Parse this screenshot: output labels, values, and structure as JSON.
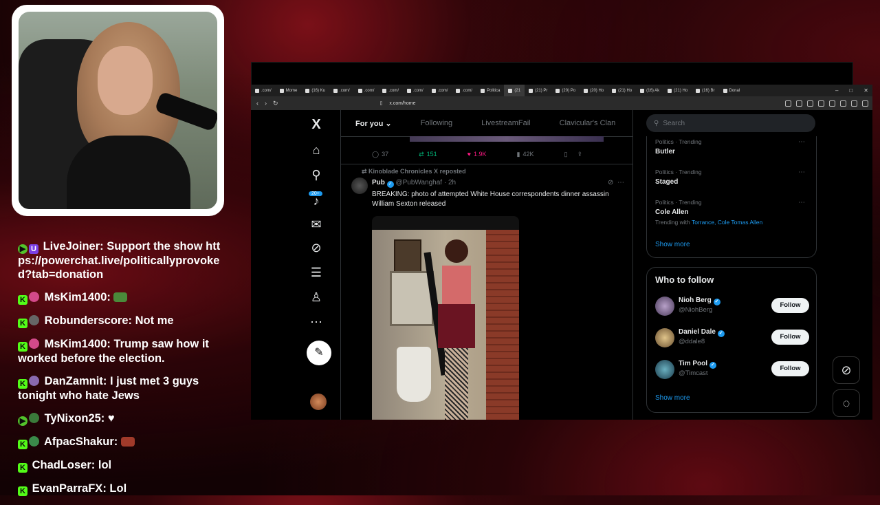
{
  "chat": [
    {
      "badge": "play",
      "badge2": "u",
      "user": "LiveJoiner:",
      "text": "Support the show https://powerchat.live/politicallyprovoked?tab=donation",
      "avatar": ""
    },
    {
      "badge": "k",
      "user": "MsKim1400:",
      "text": "",
      "avatar": "#d34a8a",
      "emote": "#4a8a3a"
    },
    {
      "badge": "k",
      "user": "Robunderscore:",
      "text": "Not me",
      "avatar": "#555"
    },
    {
      "badge": "k",
      "user": "MsKim1400:",
      "text": "Trump saw how it worked before the election.",
      "avatar": "#d34a8a"
    },
    {
      "badge": "k",
      "user": "DanZamnit:",
      "text": "I just met 3 guys tonight who hate Jews",
      "avatar": "#8a6ab0"
    },
    {
      "badge": "play",
      "user": "TyNixon25:",
      "text": "♥",
      "avatar": "#3a7a3a"
    },
    {
      "badge": "k",
      "user": "AfpacShakur:",
      "text": "",
      "avatar": "#3a8a4a",
      "emote": "#a03a2a"
    },
    {
      "badge": "k",
      "user": "ChadLoser:",
      "text": "lol",
      "avatar": ""
    },
    {
      "badge": "k",
      "user": "EvanParraFX:",
      "text": "Lol",
      "avatar": ""
    }
  ],
  "browser": {
    "tabs": [
      ".com/",
      "Mome",
      "(16) Ku",
      ".com/",
      ".com/",
      ".com/",
      ".com/",
      ".com/",
      ".com/",
      "Politica",
      "(21",
      "(21) Pr",
      "(20) Po",
      "(20) Ho",
      "(21) Ho",
      "(16) Ak",
      "(21) Ho",
      "(16) Br",
      "Donal"
    ],
    "url": "x.com/home"
  },
  "x": {
    "logo": "X",
    "nav_badge": "20+",
    "feed_tabs": [
      "For you",
      "Following",
      "LivestreamFail",
      "Clavicular's Clan"
    ],
    "prev_post_actions": {
      "replies": "37",
      "reposts": "151",
      "likes": "1.9K",
      "views": "42K"
    },
    "repost_note": "Kinoblade Chronicles X reposted",
    "tweet": {
      "name": "Pub",
      "handle": "@PubWanghaf",
      "time": "· 2h",
      "text": "BREAKING: photo of attempted White House correspondents dinner assassin William Sexton released"
    },
    "search_placeholder": "Search",
    "trends": [
      {
        "category": "Politics · Trending",
        "title": "Butler",
        "with": ""
      },
      {
        "category": "Politics · Trending",
        "title": "Staged",
        "with": ""
      },
      {
        "category": "Politics · Trending",
        "title": "Cole Allen",
        "with_prefix": "Trending with",
        "with": "Torrance, Cole Tomas Allen"
      }
    ],
    "show_more": "Show more",
    "who_to_follow": {
      "title": "Who to follow",
      "accounts": [
        {
          "name": "Nioh Berg",
          "handle": "@NiohBerg",
          "button": "Follow"
        },
        {
          "name": "Daniel Dale",
          "handle": "@ddale8",
          "button": "Follow"
        },
        {
          "name": "Tim Pool",
          "handle": "@Timcast",
          "button": "Follow"
        }
      ],
      "show_more": "Show more"
    }
  }
}
